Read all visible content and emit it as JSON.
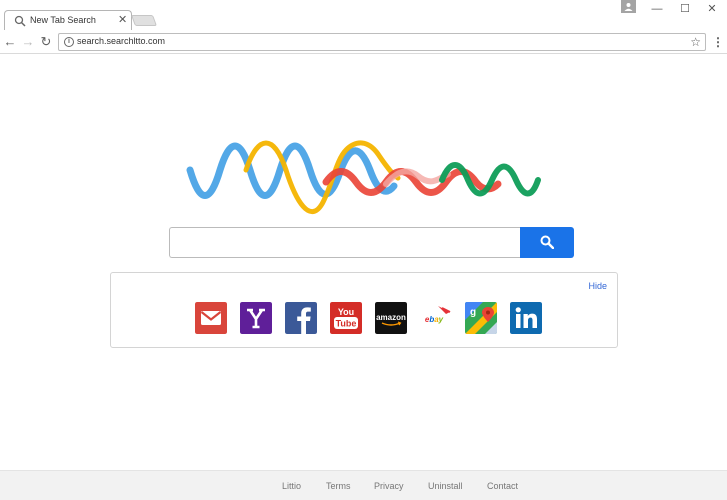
{
  "browser": {
    "tab_title": "New Tab Search",
    "tab_close": "✕",
    "url": "search.searchltto.com",
    "window_controls": {
      "minimize": "—",
      "maximize": "☐",
      "close": "✕"
    },
    "nav": {
      "back": "←",
      "forward": "→",
      "reload": "↻"
    },
    "star": "☆",
    "menu": "⋮",
    "info": "i"
  },
  "search": {
    "value": "",
    "placeholder": ""
  },
  "shortcuts": {
    "hide_label": "Hide",
    "items": [
      {
        "name": "gmail",
        "icon": "gmail-icon",
        "color": "#d9453b"
      },
      {
        "name": "yahoo",
        "icon": "yahoo-icon",
        "color": "#5f1f99"
      },
      {
        "name": "facebook",
        "icon": "facebook-icon",
        "color": "#3b5998"
      },
      {
        "name": "youtube",
        "icon": "youtube-icon",
        "color": "#d42d27"
      },
      {
        "name": "amazon",
        "icon": "amazon-icon",
        "color": "#111111"
      },
      {
        "name": "ebay",
        "icon": "ebay-icon",
        "color": "#ffffff"
      },
      {
        "name": "google-maps",
        "icon": "google-maps-icon",
        "color": "#34a853"
      },
      {
        "name": "linkedin",
        "icon": "linkedin-icon",
        "color": "#0e6ab0"
      }
    ]
  },
  "footer": {
    "links": [
      "Littio",
      "Terms",
      "Privacy",
      "Uninstall",
      "Contact"
    ]
  },
  "colors": {
    "search_button": "#1a73e8",
    "wave_blue": "#4aa3e6",
    "wave_yellow": "#f4b400",
    "wave_red": "#ea4335",
    "wave_green": "#0f9d58"
  }
}
